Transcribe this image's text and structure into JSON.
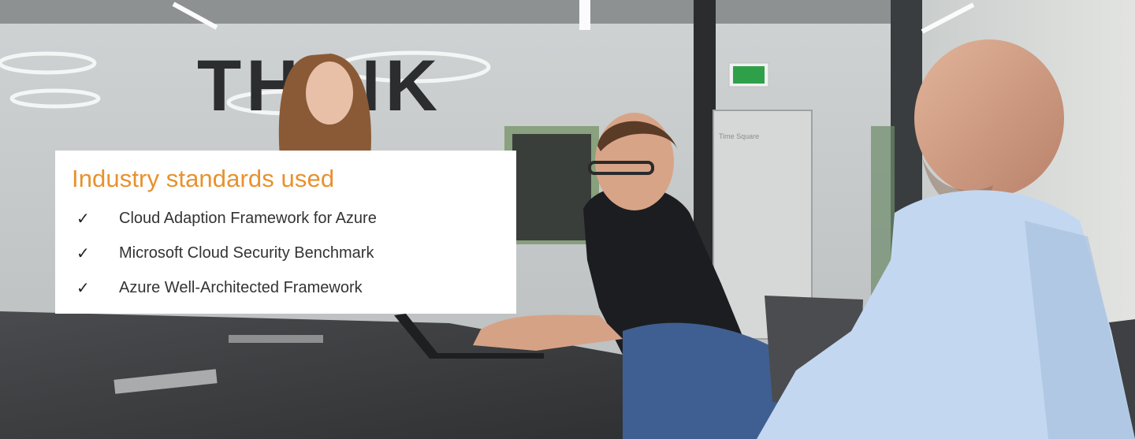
{
  "card": {
    "title": "Industry standards used",
    "items": [
      {
        "icon": "check-icon",
        "label": "Cloud Adaption Framework for Azure"
      },
      {
        "icon": "check-icon",
        "label": "Microsoft Cloud Security Benchmark"
      },
      {
        "icon": "check-icon",
        "label": "Azure Well-Architected Framework"
      }
    ],
    "check_glyph": "✓"
  },
  "photo": {
    "wall_sign_text": "THINK",
    "room_sign_text": "Time Square",
    "colors": {
      "accent": "#e8912e",
      "exit_sign": "#2fa04a",
      "table": "#3b3c3e",
      "shirt_dark": "#1c1d20",
      "shirt_light": "#c3d8f0"
    }
  }
}
